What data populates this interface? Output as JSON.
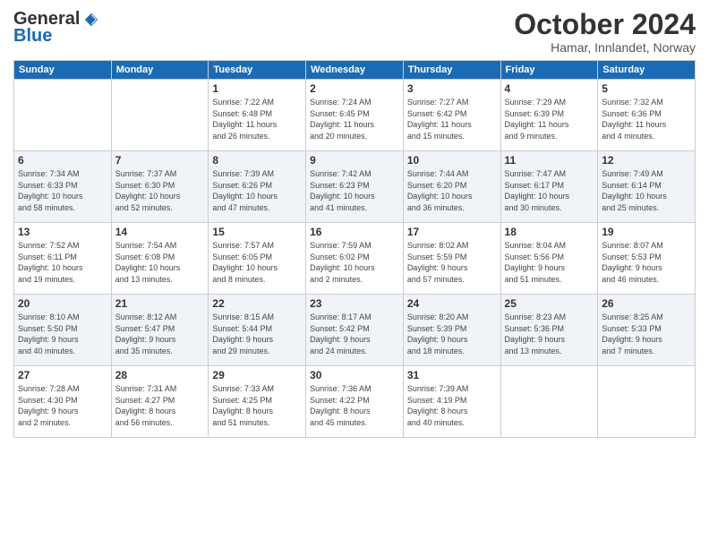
{
  "logo": {
    "general": "General",
    "blue": "Blue"
  },
  "title": "October 2024",
  "subtitle": "Hamar, Innlandet, Norway",
  "days_of_week": [
    "Sunday",
    "Monday",
    "Tuesday",
    "Wednesday",
    "Thursday",
    "Friday",
    "Saturday"
  ],
  "weeks": [
    [
      {
        "day": "",
        "info": ""
      },
      {
        "day": "",
        "info": ""
      },
      {
        "day": "1",
        "info": "Sunrise: 7:22 AM\nSunset: 6:48 PM\nDaylight: 11 hours\nand 26 minutes."
      },
      {
        "day": "2",
        "info": "Sunrise: 7:24 AM\nSunset: 6:45 PM\nDaylight: 11 hours\nand 20 minutes."
      },
      {
        "day": "3",
        "info": "Sunrise: 7:27 AM\nSunset: 6:42 PM\nDaylight: 11 hours\nand 15 minutes."
      },
      {
        "day": "4",
        "info": "Sunrise: 7:29 AM\nSunset: 6:39 PM\nDaylight: 11 hours\nand 9 minutes."
      },
      {
        "day": "5",
        "info": "Sunrise: 7:32 AM\nSunset: 6:36 PM\nDaylight: 11 hours\nand 4 minutes."
      }
    ],
    [
      {
        "day": "6",
        "info": "Sunrise: 7:34 AM\nSunset: 6:33 PM\nDaylight: 10 hours\nand 58 minutes."
      },
      {
        "day": "7",
        "info": "Sunrise: 7:37 AM\nSunset: 6:30 PM\nDaylight: 10 hours\nand 52 minutes."
      },
      {
        "day": "8",
        "info": "Sunrise: 7:39 AM\nSunset: 6:26 PM\nDaylight: 10 hours\nand 47 minutes."
      },
      {
        "day": "9",
        "info": "Sunrise: 7:42 AM\nSunset: 6:23 PM\nDaylight: 10 hours\nand 41 minutes."
      },
      {
        "day": "10",
        "info": "Sunrise: 7:44 AM\nSunset: 6:20 PM\nDaylight: 10 hours\nand 36 minutes."
      },
      {
        "day": "11",
        "info": "Sunrise: 7:47 AM\nSunset: 6:17 PM\nDaylight: 10 hours\nand 30 minutes."
      },
      {
        "day": "12",
        "info": "Sunrise: 7:49 AM\nSunset: 6:14 PM\nDaylight: 10 hours\nand 25 minutes."
      }
    ],
    [
      {
        "day": "13",
        "info": "Sunrise: 7:52 AM\nSunset: 6:11 PM\nDaylight: 10 hours\nand 19 minutes."
      },
      {
        "day": "14",
        "info": "Sunrise: 7:54 AM\nSunset: 6:08 PM\nDaylight: 10 hours\nand 13 minutes."
      },
      {
        "day": "15",
        "info": "Sunrise: 7:57 AM\nSunset: 6:05 PM\nDaylight: 10 hours\nand 8 minutes."
      },
      {
        "day": "16",
        "info": "Sunrise: 7:59 AM\nSunset: 6:02 PM\nDaylight: 10 hours\nand 2 minutes."
      },
      {
        "day": "17",
        "info": "Sunrise: 8:02 AM\nSunset: 5:59 PM\nDaylight: 9 hours\nand 57 minutes."
      },
      {
        "day": "18",
        "info": "Sunrise: 8:04 AM\nSunset: 5:56 PM\nDaylight: 9 hours\nand 51 minutes."
      },
      {
        "day": "19",
        "info": "Sunrise: 8:07 AM\nSunset: 5:53 PM\nDaylight: 9 hours\nand 46 minutes."
      }
    ],
    [
      {
        "day": "20",
        "info": "Sunrise: 8:10 AM\nSunset: 5:50 PM\nDaylight: 9 hours\nand 40 minutes."
      },
      {
        "day": "21",
        "info": "Sunrise: 8:12 AM\nSunset: 5:47 PM\nDaylight: 9 hours\nand 35 minutes."
      },
      {
        "day": "22",
        "info": "Sunrise: 8:15 AM\nSunset: 5:44 PM\nDaylight: 9 hours\nand 29 minutes."
      },
      {
        "day": "23",
        "info": "Sunrise: 8:17 AM\nSunset: 5:42 PM\nDaylight: 9 hours\nand 24 minutes."
      },
      {
        "day": "24",
        "info": "Sunrise: 8:20 AM\nSunset: 5:39 PM\nDaylight: 9 hours\nand 18 minutes."
      },
      {
        "day": "25",
        "info": "Sunrise: 8:23 AM\nSunset: 5:36 PM\nDaylight: 9 hours\nand 13 minutes."
      },
      {
        "day": "26",
        "info": "Sunrise: 8:25 AM\nSunset: 5:33 PM\nDaylight: 9 hours\nand 7 minutes."
      }
    ],
    [
      {
        "day": "27",
        "info": "Sunrise: 7:28 AM\nSunset: 4:30 PM\nDaylight: 9 hours\nand 2 minutes."
      },
      {
        "day": "28",
        "info": "Sunrise: 7:31 AM\nSunset: 4:27 PM\nDaylight: 8 hours\nand 56 minutes."
      },
      {
        "day": "29",
        "info": "Sunrise: 7:33 AM\nSunset: 4:25 PM\nDaylight: 8 hours\nand 51 minutes."
      },
      {
        "day": "30",
        "info": "Sunrise: 7:36 AM\nSunset: 4:22 PM\nDaylight: 8 hours\nand 45 minutes."
      },
      {
        "day": "31",
        "info": "Sunrise: 7:39 AM\nSunset: 4:19 PM\nDaylight: 8 hours\nand 40 minutes."
      },
      {
        "day": "",
        "info": ""
      },
      {
        "day": "",
        "info": ""
      }
    ]
  ]
}
